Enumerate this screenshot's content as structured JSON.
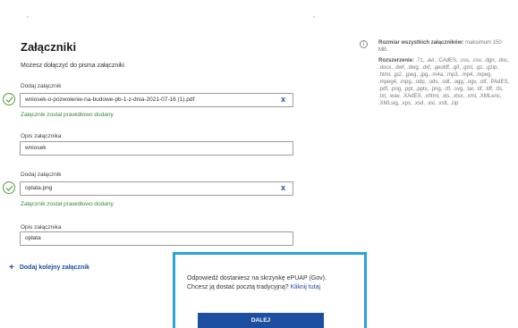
{
  "attachments": {
    "title": "Załączniki",
    "subtitle": "Możesz dołączyć do pisma załączniki",
    "items": [
      {
        "file_label": "Dodaj załącznik",
        "file_name": "wniosek-o-pozwolenie-na-budowe-pb-1-z-dnia-2021-07-16 (1).pdf",
        "remove_label": "x",
        "success": "Załącznik został prawidłowo dodany",
        "desc_label": "Opis załącznika",
        "desc_value": "wniosek"
      },
      {
        "file_label": "Dodaj załącznik",
        "file_name": "oplata.png",
        "remove_label": "x",
        "success": "Załącznik został prawidłowo dodany",
        "desc_label": "Opis załącznika",
        "desc_value": "opłata"
      }
    ],
    "add_more": "Dodaj kolejny załącznik"
  },
  "info": {
    "size_label": "Rozmiar wszystkich załączników:",
    "size_value": "maksimum 150 MB.",
    "ext_label": "Rozszerzenie:",
    "ext_value": ".7z, .avi, .CAdES, .css, .csv, .dgn, .doc, .docx, .dwf, .dwg, .dxf, .geotiff, .gif, .gml, .gz, .gzip, .html, .jp2, .jpeg, .jpg, .m4a, .mp3, .mp4, .mpeg, .mpeg4, .mpg, .odp, .ods, .odt, .ogg, .ogv, .otf, .PAdES, .pdf, .png, .ppt, .pptx, .png, .rtf, .svg, .tar, .tif, .tiff, .tls, .txt, .wav, .XAdES, .xhtml, .xls, .xlsx, .xml, .XMLenc, .XMLsig, .xps, .xsd, .xsl, .xslt, .zip"
  },
  "modal": {
    "line1": "Odpowiedź dostaniesz na skrzynkę ePUAP (Gov).",
    "line2": "Chcesz ją dostać pocztą tradycyjną?",
    "link": "Kliknij tutaj",
    "button": "DALEJ"
  },
  "colors": {
    "primary": "#1d4fa0",
    "success": "#3a8a3a",
    "modal_border": "#2aa3dd"
  }
}
